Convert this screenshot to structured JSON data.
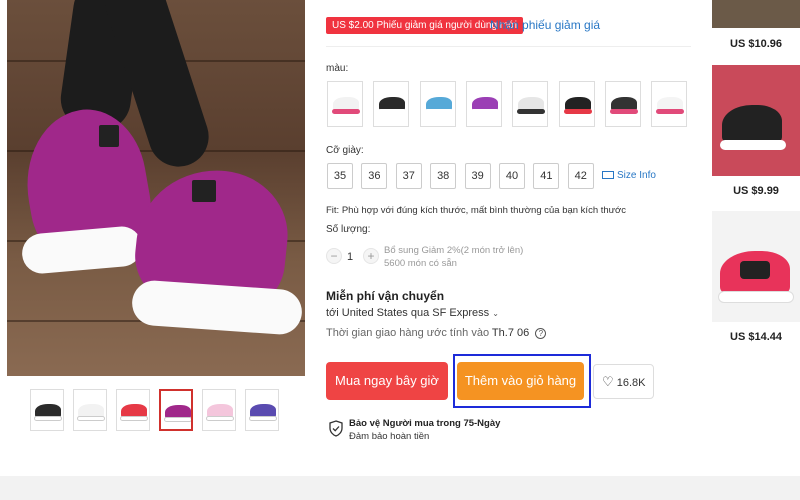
{
  "coupon": {
    "text": "US $2.00 Phiếu giảm giá người dùng mới",
    "link": "Nhận phiếu giảm giá"
  },
  "color": {
    "label": "màu:",
    "options": [
      {
        "shoe": "#f2f2f2",
        "sole": "#e14a7a"
      },
      {
        "shoe": "#2a2a2a",
        "sole": "#ffffff"
      },
      {
        "shoe": "#56a9d8",
        "sole": "#ffffff"
      },
      {
        "shoe": "#9b3fb5",
        "sole": "#ffffff"
      },
      {
        "shoe": "#e6e6e6",
        "sole": "#333333"
      },
      {
        "shoe": "#222222",
        "sole": "#e63946"
      },
      {
        "shoe": "#333333",
        "sole": "#e14a7a"
      },
      {
        "shoe": "#f4f4f4",
        "sole": "#e14a7a"
      }
    ]
  },
  "size": {
    "label": "Cỡ giày:",
    "options": [
      "35",
      "36",
      "37",
      "38",
      "39",
      "40",
      "41",
      "42"
    ],
    "info": "Size Info"
  },
  "fit": "Fit: Phù hợp với đúng kích thước, mất bình thường của bạn kích thước",
  "quantity": {
    "label": "Số lượng:",
    "minus": "−",
    "plus": "+",
    "value": "1",
    "note1": "Bổ sung Giảm 2%(2 món trở lên)",
    "note2": "5600 món có sẵn"
  },
  "shipping": {
    "title": "Miễn phí vận chuyển",
    "to": "tới United States qua SF Express",
    "eta_prefix": "Thời gian giao hàng ước tính vào",
    "eta_date": "Th.7 06",
    "help": "?"
  },
  "buttons": {
    "buy_now": "Mua ngay bây giờ",
    "add_to_cart": "Thêm vào giỏ hàng",
    "wishlist_count": "16.8K"
  },
  "protection": {
    "title": "Bảo vệ Người mua trong 75-Ngày",
    "subtitle": "Đảm bảo hoàn tiền"
  },
  "related": [
    {
      "price": "US $10.96"
    },
    {
      "price": "US $9.99"
    },
    {
      "price": "US $14.44"
    }
  ],
  "thumbnails": [
    {
      "shoe": "#2b2b2b",
      "sole": "#ffffff"
    },
    {
      "shoe": "#f2f2f2",
      "sole": "#ffffff"
    },
    {
      "shoe": "#e63946",
      "sole": "#ffffff"
    },
    {
      "shoe": "#a0288a",
      "sole": "#ffffff",
      "active": true
    },
    {
      "shoe": "#f4c6dc",
      "sole": "#ffffff"
    },
    {
      "shoe": "#5a4bb0",
      "sole": "#ffffff"
    }
  ],
  "colors": {
    "accent_red": "#ef4444",
    "accent_orange": "#f59322",
    "link_blue": "#2877c5",
    "highlight_blue": "#1d2bd9"
  }
}
